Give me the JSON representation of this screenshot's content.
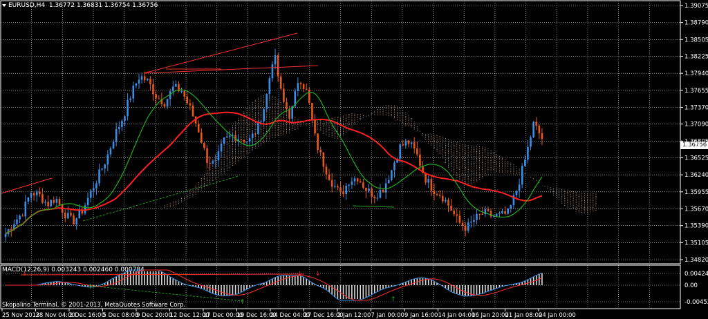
{
  "chart_info": {
    "symbol_timeframe": "EURUSD,H4",
    "ohlc": "1.36772 1.36831 1.36754 1.36756",
    "current_price": "1.36756"
  },
  "macd": {
    "label": "MACD(12,26,9) 0.003243 0.002460 0.000784",
    "y_labels": [
      "0.004246",
      "0.00",
      "-0.004521"
    ]
  },
  "copyright": "Skopalino Terminal, © 2001-2013, MetaQuotes Software Corp.",
  "colors": {
    "background": "#000000",
    "grid": "#ffffff",
    "bull": "#3a8ee6",
    "bear": "#e8581c",
    "ma_red": "#ff2020",
    "ma_green": "#1fae1f",
    "cloud": "#e9b79a",
    "trend": "#ff3030",
    "dashed": "#20c020"
  },
  "chart_data": {
    "type": "candlestick",
    "price_axis_labels": [
      "1.39075",
      "1.38790",
      "1.38505",
      "1.38225",
      "1.37940",
      "1.37655",
      "1.37370",
      "1.37090",
      "1.36805",
      "1.36525",
      "1.36240",
      "1.35955",
      "1.35670",
      "1.35390",
      "1.35105",
      "1.34820"
    ],
    "time_axis_labels": [
      "25 Nov 2013",
      "28 Nov 04:00",
      "2 Dec 16:00",
      "5 Dec 08:00",
      "9 Dec 20:00",
      "12 Dec 12:00",
      "17 Dec 00:00",
      "19 Dec 16:00",
      "24 Dec 04:00",
      "27 Dec 16:00",
      "2 Jan 12:00",
      "7 Jan 00:00",
      "9 Jan 16:00",
      "14 Jan 04:00",
      "16 Jan 20:00",
      "21 Jan 08:00",
      "24 Jan 00:00"
    ],
    "price_path": [
      1.3525,
      1.3545,
      1.356,
      1.3595,
      1.359,
      1.3575,
      1.3585,
      1.356,
      1.3545,
      1.356,
      1.359,
      1.362,
      1.365,
      1.369,
      1.372,
      1.376,
      1.379,
      1.378,
      1.3755,
      1.3745,
      1.377,
      1.3765,
      1.3735,
      1.37,
      1.365,
      1.364,
      1.368,
      1.369,
      1.3685,
      1.368,
      1.37,
      1.3745,
      1.383,
      1.375,
      1.372,
      1.379,
      1.376,
      1.368,
      1.364,
      1.361,
      1.359,
      1.3615,
      1.362,
      1.36,
      1.359,
      1.36,
      1.363,
      1.367,
      1.368,
      1.366,
      1.362,
      1.36,
      1.359,
      1.357,
      1.3545,
      1.3535,
      1.355,
      1.356,
      1.3555,
      1.3555,
      1.356,
      1.36,
      1.365,
      1.371,
      1.3685
    ],
    "macd_series": {
      "signal_line": "blue",
      "main_line": "red",
      "histogram": "white"
    }
  }
}
